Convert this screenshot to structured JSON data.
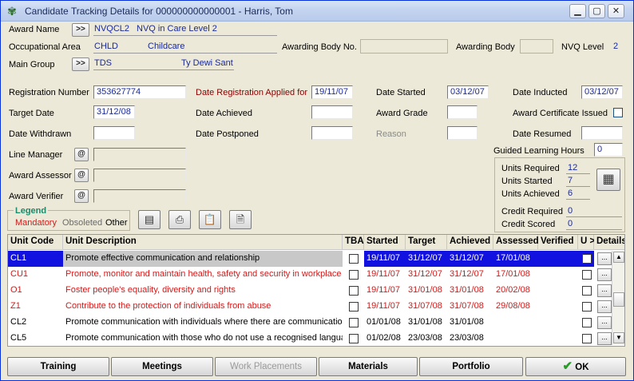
{
  "window": {
    "title": "Candidate Tracking Details for 000000000000001 - Harris, Tom"
  },
  "header": {
    "award_name_label": "Award Name",
    "award_code": "NVQCL2",
    "award_title": "NVQ in Care Level 2",
    "occ_area_label": "Occupational Area",
    "occ_code": "CHLD",
    "occ_name": "Childcare",
    "awarding_body_no_label": "Awarding Body No.",
    "awarding_body_no": "",
    "awarding_body_label": "Awarding Body",
    "awarding_body": "",
    "nvq_level_label": "NVQ Level",
    "nvq_level": "2",
    "main_group_label": "Main Group",
    "group_code": "TDS",
    "group_name": "Ty Dewi Sant",
    "nav_button": ">>"
  },
  "form": {
    "reg_number_label": "Registration Number",
    "reg_number": "353627774",
    "date_reg_applied_label": "Date Registration Applied for",
    "date_reg_applied": "19/11/07",
    "date_started_label": "Date Started",
    "date_started": "03/12/07",
    "date_inducted_label": "Date Inducted",
    "date_inducted": "03/12/07",
    "target_date_label": "Target Date",
    "target_date": "31/12/08",
    "date_achieved_label": "Date Achieved",
    "date_achieved": "",
    "award_grade_label": "Award Grade",
    "award_grade": "",
    "award_cert_label": "Award Certificate Issued",
    "date_withdrawn_label": "Date Withdrawn",
    "date_withdrawn": "",
    "date_postponed_label": "Date Postponed",
    "date_postponed": "",
    "reason_label": "Reason",
    "reason": "",
    "date_resumed_label": "Date Resumed",
    "date_resumed": "",
    "glh_label": "Guided Learning Hours",
    "glh": "0",
    "line_manager_label": "Line Manager",
    "award_assessor_label": "Award Assessor",
    "award_verifier_label": "Award Verifier",
    "at_symbol": "@"
  },
  "units_summary": {
    "required_label": "Units Required",
    "required": "12",
    "started_label": "Units Started",
    "started": "7",
    "achieved_label": "Units Achieved",
    "achieved": "6",
    "credit_required_label": "Credit Required",
    "credit_required": "0",
    "credit_scored_label": "Credit Scored",
    "credit_scored": "0"
  },
  "legend": {
    "title": "Legend",
    "mandatory": "Mandatory",
    "obsoleted": "Obsoleted",
    "other": "Other"
  },
  "grid": {
    "headers": [
      "Unit Code",
      "Unit Description",
      "TBA",
      "Started",
      "Target",
      "Achieved",
      "Assessed",
      "Verified",
      "U >",
      "Details"
    ],
    "rows": [
      {
        "code": "CL1",
        "desc": "Promote effective communication and relationship",
        "started": "19/11/07",
        "target": "31/12/07",
        "achieved": "31/12/07",
        "assessed": "17/01/08",
        "verified": "",
        "dots": "..."
      },
      {
        "code": "CU1",
        "desc": "Promote, monitor and maintain health, safety and security in workplace",
        "started": "19/11/07",
        "target": "31/12/07",
        "achieved": "31/12/07",
        "assessed": "17/01/08",
        "verified": "",
        "dots": "..."
      },
      {
        "code": "O1",
        "desc": "Foster people's equality, diversity and rights",
        "started": "19/11/07",
        "target": "31/01/08",
        "achieved": "31/01/08",
        "assessed": "20/02/08",
        "verified": "",
        "dots": "..."
      },
      {
        "code": "Z1",
        "desc": "Contribute to the protection of individuals from abuse",
        "started": "19/11/07",
        "target": "31/07/08",
        "achieved": "31/07/08",
        "assessed": "29/08/08",
        "verified": "",
        "dots": "..."
      },
      {
        "code": "CL2",
        "desc": "Promote communication with individuals where there are communication d",
        "started": "01/01/08",
        "target": "31/01/08",
        "achieved": "31/01/08",
        "assessed": "",
        "verified": "",
        "dots": "..."
      },
      {
        "code": "CL5",
        "desc": "Promote communication with those who do not use a recognised language",
        "started": "01/02/08",
        "target": "23/03/08",
        "achieved": "23/03/08",
        "assessed": "",
        "verified": "",
        "dots": "..."
      }
    ]
  },
  "buttons": {
    "training": "Training",
    "meetings": "Meetings",
    "work_placements": "Work Placements",
    "materials": "Materials",
    "portfolio": "Portfolio",
    "ok": "OK"
  },
  "colors": {
    "mandatory": "#d21a1a",
    "selection": "#1212e0",
    "value_text": "#1a2a9a",
    "legend_title": "#1a8a6a"
  }
}
